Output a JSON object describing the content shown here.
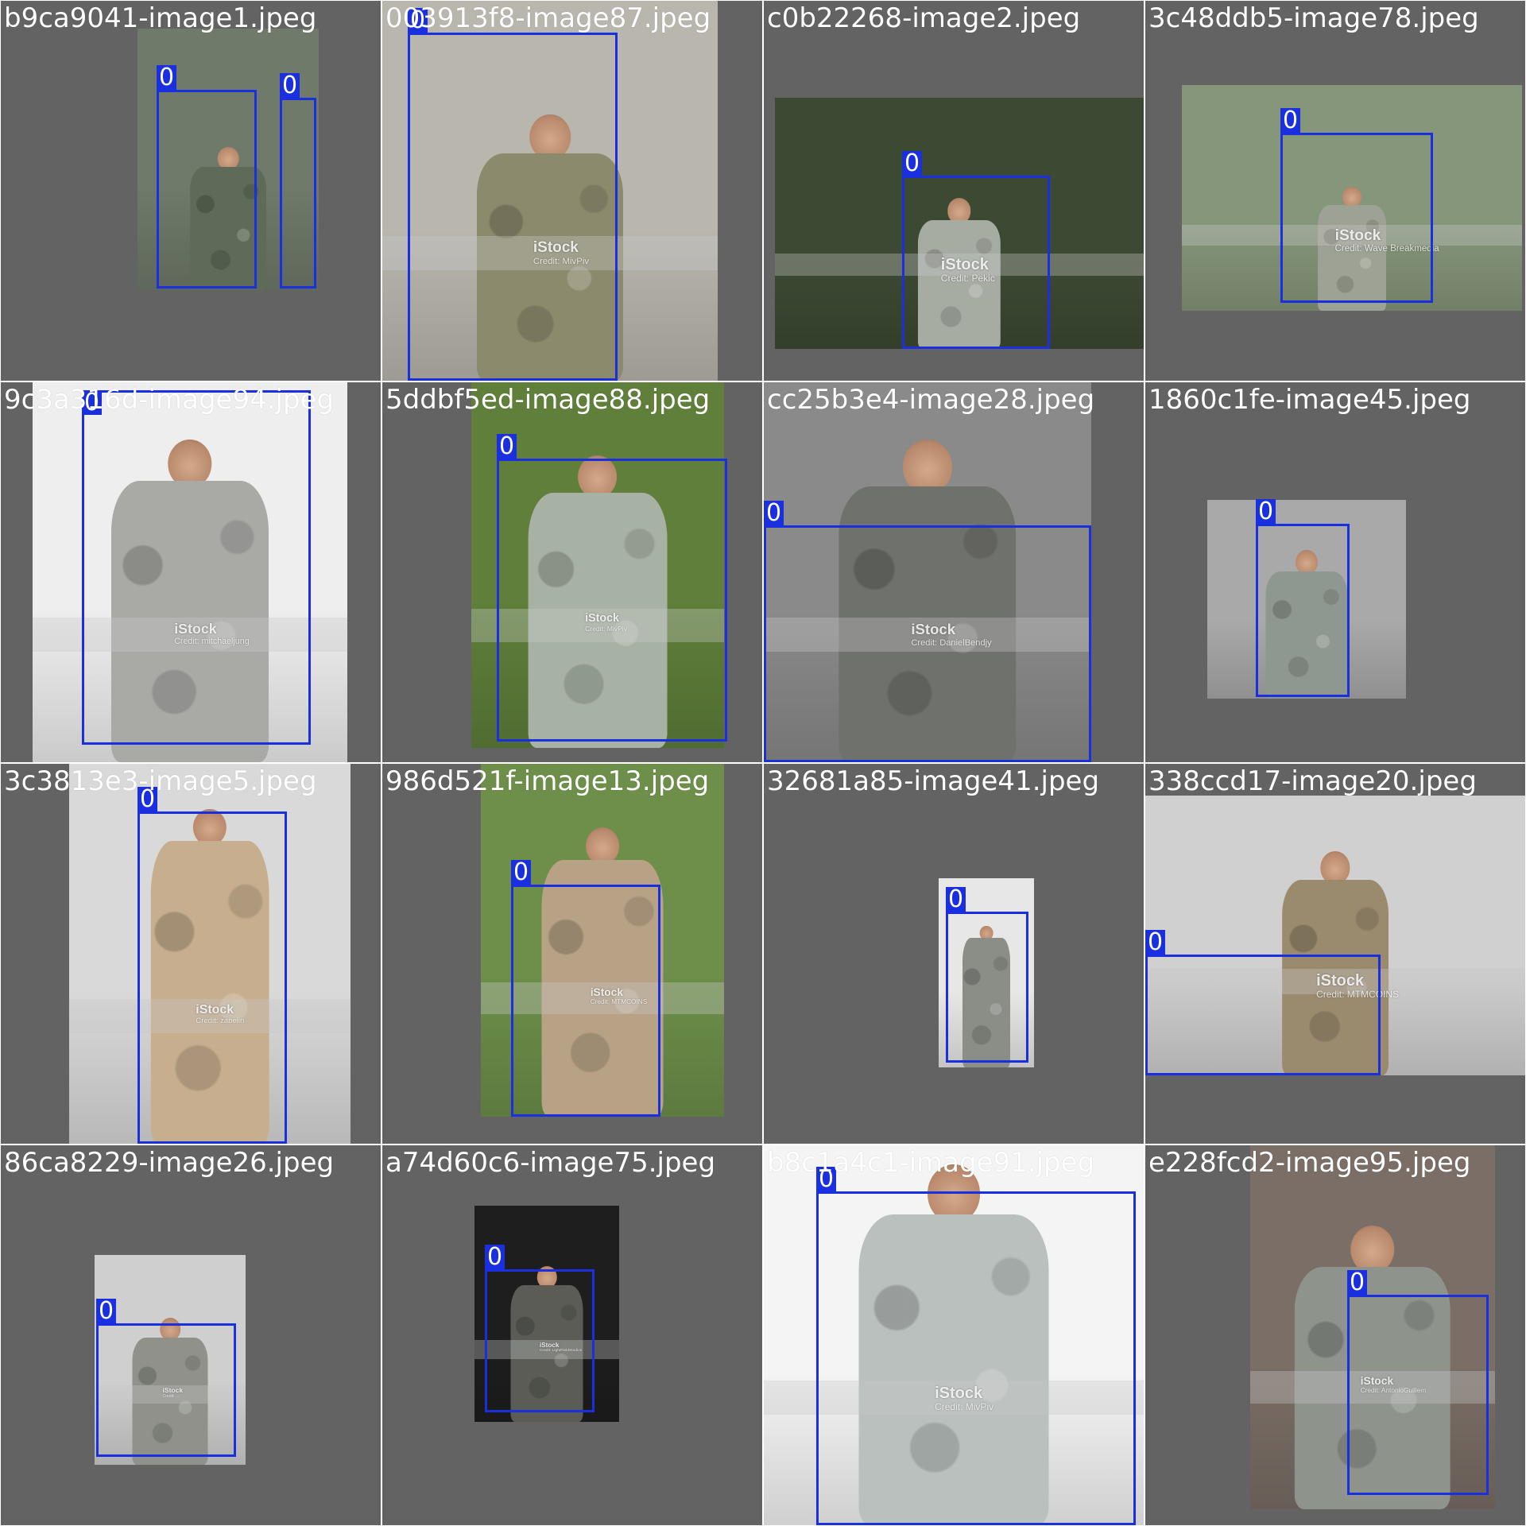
{
  "colors": {
    "cell_background": "#636363",
    "box_color": "#1a2fe0",
    "label_text": "#ffffff"
  },
  "tiles": [
    {
      "label": "b9ca9041-image1.jpeg",
      "boxes": [
        "0",
        "0"
      ],
      "bg": "#626262",
      "photo": "#6f7a6a",
      "uniform": "#5d6b58",
      "watermark": null
    },
    {
      "label": "003913f8-image87.jpeg",
      "boxes": [
        "0"
      ],
      "bg": "#626262",
      "photo": "#b9b6ae",
      "uniform": "#8c8a6c",
      "watermark": {
        "brand": "iStock",
        "credit": "Credit: MivPiv"
      }
    },
    {
      "label": "c0b22268-image2.jpeg",
      "boxes": [
        "0"
      ],
      "bg": "#626262",
      "photo": "#3d4a33",
      "uniform": "#a7aca3",
      "watermark": {
        "brand": "iStock",
        "credit": "Credit: Pekic"
      }
    },
    {
      "label": "3c48ddb5-image78.jpeg",
      "boxes": [
        "0"
      ],
      "bg": "#626262",
      "photo": "#86967a",
      "uniform": "#9ea294",
      "watermark": {
        "brand": "iStock",
        "credit": "Credit: Wave Breakmedia"
      }
    },
    {
      "label": "9c3a316d-image94.jpeg",
      "boxes": [
        "0"
      ],
      "bg": "#626262",
      "photo": "#eeeeee",
      "uniform": "#a9aaa6",
      "watermark": {
        "brand": "iStock",
        "credit": "Credit: mitchaeljung"
      }
    },
    {
      "label": "5ddbf5ed-image88.jpeg",
      "boxes": [
        "0"
      ],
      "bg": "#626262",
      "photo": "#5f7f3a",
      "uniform": "#a8b2a4",
      "watermark": {
        "brand": "iStock",
        "credit": "Credit: MivPiv"
      }
    },
    {
      "label": "cc25b3e4-image28.jpeg",
      "boxes": [
        "0"
      ],
      "bg": "#626262",
      "photo": "#8a8a8a",
      "uniform": "#6f716c",
      "watermark": {
        "brand": "iStock",
        "credit": "Credit: DanielBendjy"
      }
    },
    {
      "label": "1860c1fe-image45.jpeg",
      "boxes": [
        "0"
      ],
      "bg": "#626262",
      "photo": "#a9a9a9",
      "uniform": "#8f9890",
      "watermark": null
    },
    {
      "label": "3c3813e3-image5.jpeg",
      "boxes": [
        "0"
      ],
      "bg": "#626262",
      "photo": "#d9d9d9",
      "uniform": "#c6ae8e",
      "watermark": {
        "brand": "iStock",
        "credit": "Credit: zabelin"
      }
    },
    {
      "label": "986d521f-image13.jpeg",
      "boxes": [
        "0"
      ],
      "bg": "#626262",
      "photo": "#6d8f4a",
      "uniform": "#b7a285",
      "watermark": {
        "brand": "iStock",
        "credit": "Credit: MTMCOINS"
      }
    },
    {
      "label": "32681a85-image41.jpeg",
      "boxes": [
        "0"
      ],
      "bg": "#626262",
      "photo": "#e7e7e7",
      "uniform": "#8a8e86",
      "watermark": null
    },
    {
      "label": "338ccd17-image20.jpeg",
      "boxes": [
        "0"
      ],
      "bg": "#626262",
      "photo": "#d0d0d0",
      "uniform": "#9a8a6e",
      "watermark": {
        "brand": "iStock",
        "credit": "Credit: MTMCOINS"
      }
    },
    {
      "label": "86ca8229-image26.jpeg",
      "boxes": [
        "0"
      ],
      "bg": "#626262",
      "photo": "#cfcfcf",
      "uniform": "#8f918a",
      "watermark": {
        "brand": "iStock",
        "credit": "Credit: ..."
      }
    },
    {
      "label": "a74d60c6-image75.jpeg",
      "boxes": [
        "0"
      ],
      "bg": "#626262",
      "photo": "#1e1e1e",
      "uniform": "#5a5c55",
      "watermark": {
        "brand": "iStock",
        "credit": "Credit: LightFieldStudios"
      }
    },
    {
      "label": "b8c1a4c1-image91.jpeg",
      "boxes": [
        "0"
      ],
      "bg": "#626262",
      "photo": "#f4f4f4",
      "uniform": "#b9c0bd",
      "watermark": {
        "brand": "iStock",
        "credit": "Credit: MivPiv"
      }
    },
    {
      "label": "e228fcd2-image95.jpeg",
      "boxes": [
        "0"
      ],
      "bg": "#626262",
      "photo": "#7a6e66",
      "uniform": "#8e938c",
      "watermark": {
        "brand": "iStock",
        "credit": "Credit: AntonioGuillem"
      }
    }
  ]
}
